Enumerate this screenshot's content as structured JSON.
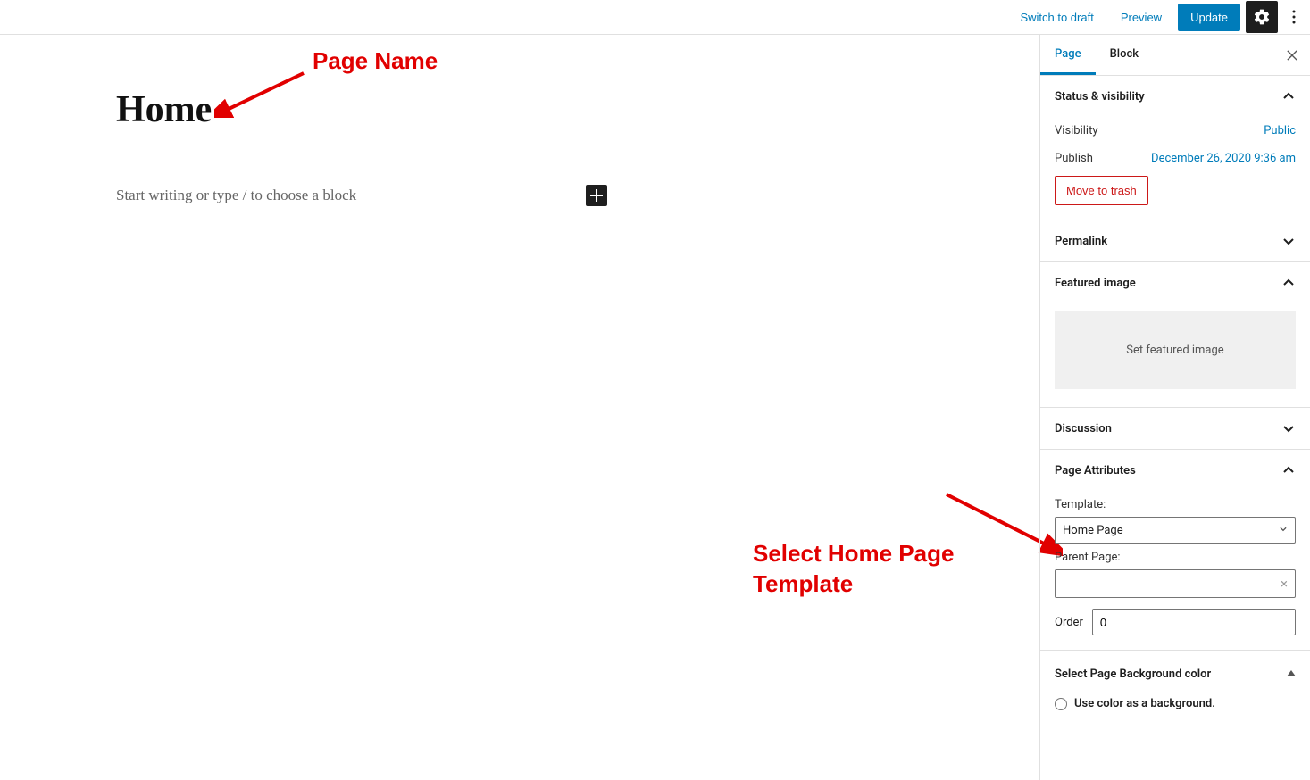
{
  "header": {
    "switch_to_draft": "Switch to draft",
    "preview": "Preview",
    "update": "Update"
  },
  "editor": {
    "title": "Home",
    "placeholder": "Start writing or type / to choose a block"
  },
  "sidebar": {
    "tabs": {
      "page": "Page",
      "block": "Block"
    },
    "status": {
      "title": "Status & visibility",
      "visibility_label": "Visibility",
      "visibility_value": "Public",
      "publish_label": "Publish",
      "publish_value": "December 26, 2020 9:36 am",
      "trash": "Move to trash"
    },
    "permalink": {
      "title": "Permalink"
    },
    "featured": {
      "title": "Featured image",
      "button": "Set featured image"
    },
    "discussion": {
      "title": "Discussion"
    },
    "attributes": {
      "title": "Page Attributes",
      "template_label": "Template:",
      "template_value": "Home Page",
      "parent_label": "Parent Page:",
      "parent_value": "",
      "order_label": "Order",
      "order_value": "0"
    },
    "bgcolor": {
      "title": "Select Page Background color",
      "option1": "Use color as a background."
    }
  },
  "annotations": {
    "page_name": "Page Name",
    "select_template": "Select Home Page Template"
  }
}
